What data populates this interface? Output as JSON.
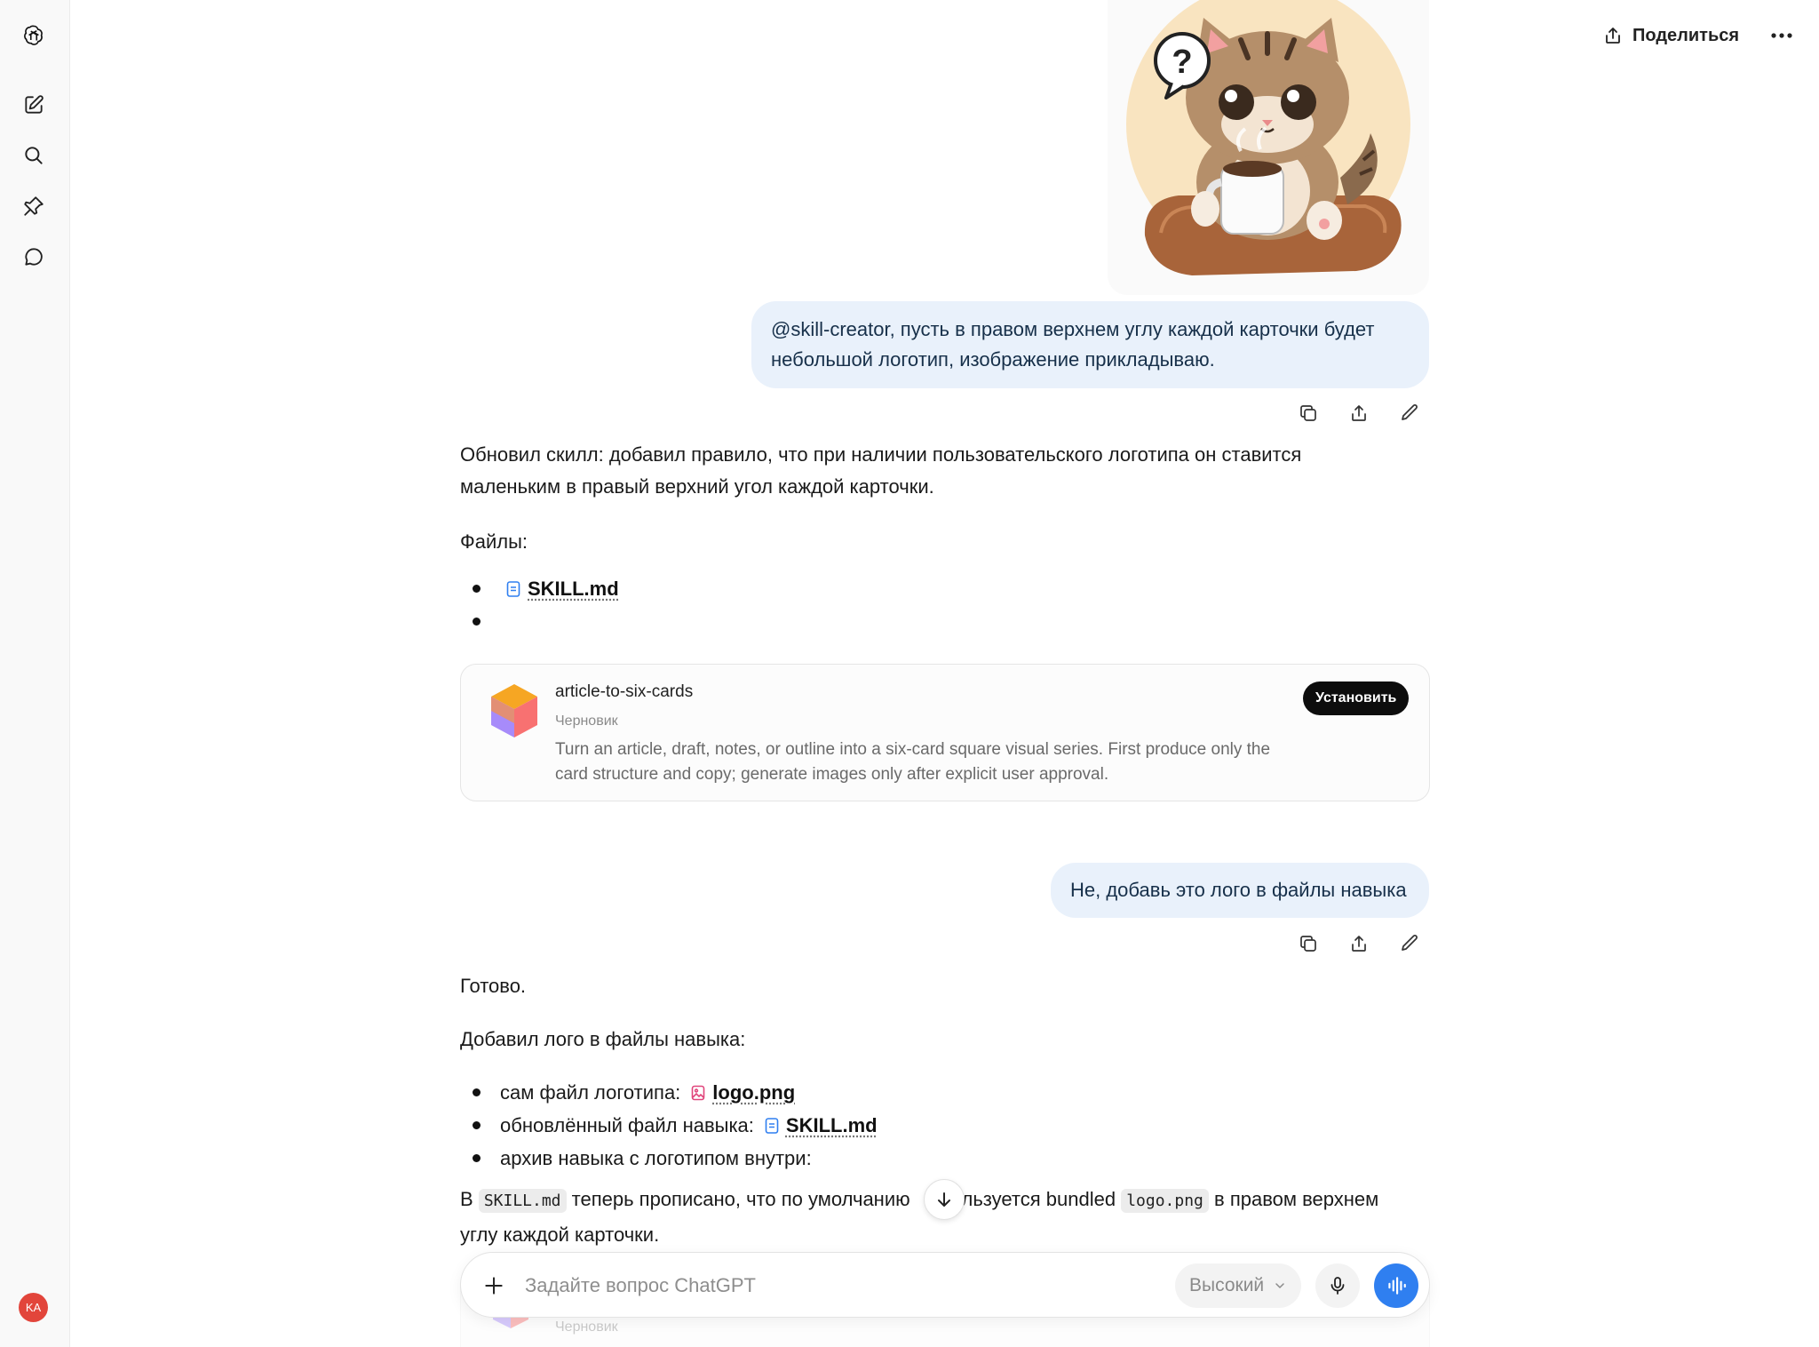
{
  "sidebar": {
    "items": [
      {
        "name": "openai-logo-icon"
      },
      {
        "name": "new-chat-icon"
      },
      {
        "name": "search-icon"
      },
      {
        "name": "pin-icon"
      },
      {
        "name": "chat-bubble-icon"
      }
    ],
    "avatar_initials": "KA",
    "avatar_color": "#e2453b"
  },
  "header": {
    "share_label": "Поделиться",
    "more_icon": "ellipsis-icon"
  },
  "conversation": {
    "user_msg_1": "@skill-creator, пусть в правом верхнем углу каждой карточки будет небольшой логотип, изображение прикладываю.",
    "assistant_1": {
      "intro": "Обновил скилл: добавил правило, что при наличии пользовательского логотипа он ставится маленьким в правый верхний угол каждой карточки.",
      "files_label": "Файлы:",
      "files": [
        "SKILL.md",
        ""
      ]
    },
    "skill_card": {
      "name": "article-to-six-cards",
      "status": "Черновик",
      "description": "Turn an article, draft, notes, or outline into a six-card square visual series. First produce only the card structure and copy; generate images only after explicit user approval.",
      "install_label": "Установить"
    },
    "user_msg_2": "Не, добавь это лого в файлы навыка",
    "assistant_2": {
      "line1": "Готово.",
      "line2": "Добавил лого в файлы навыка:",
      "bullets": [
        {
          "text": "сам файл логотипа:",
          "file": "logo.png"
        },
        {
          "text": "обновлённый файл навыка:",
          "file": "SKILL.md"
        },
        {
          "text": "архив навыка с логотипом внутри:",
          "file": ""
        }
      ],
      "para_prefix": "В",
      "para_code1": "SKILL.md",
      "para_mid": "теперь прописано, что по умолчанию",
      "para_mid2": "ользуется bundled",
      "para_code2": "logo.png",
      "para_suffix": "в правом верхнем",
      "para_line2": "углу каждой карточки."
    },
    "peek_card_status": "Черновик"
  },
  "composer": {
    "placeholder": "Задайте вопрос ChatGPT",
    "effort_label": "Высокий",
    "accent": "#2f7ff0"
  }
}
